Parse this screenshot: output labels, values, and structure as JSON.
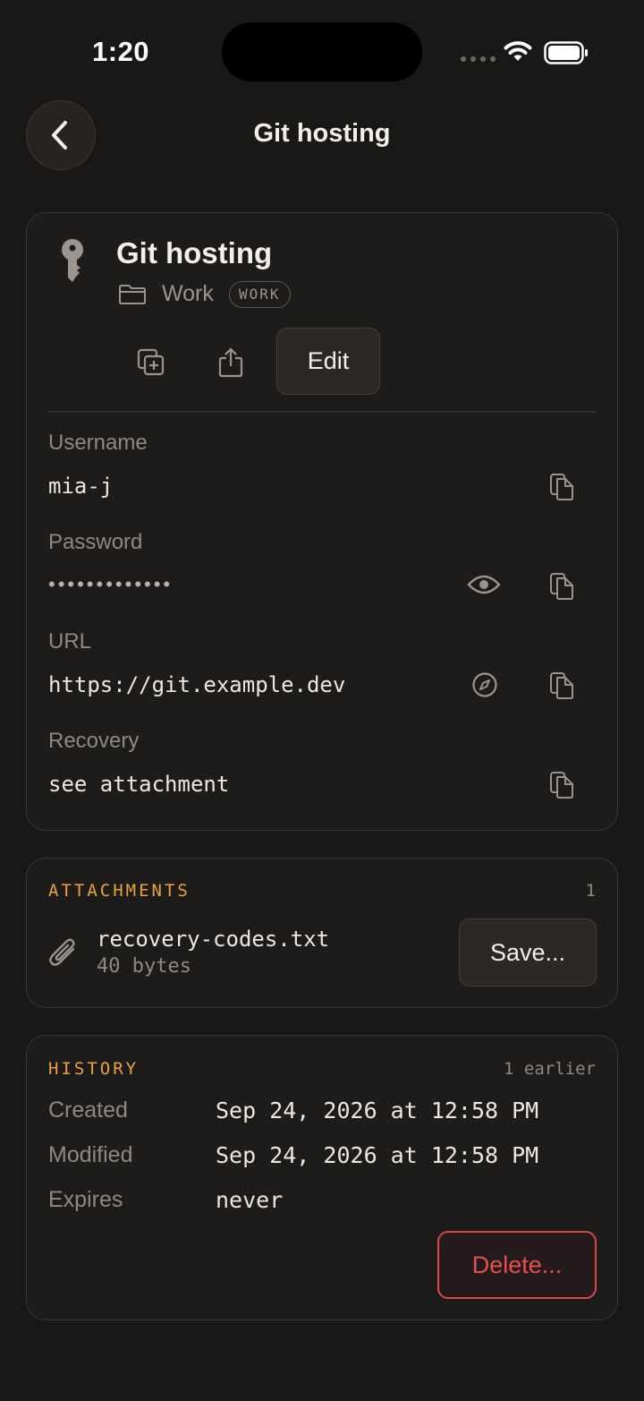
{
  "status_bar": {
    "time": "1:20"
  },
  "nav": {
    "title": "Git hosting"
  },
  "entry": {
    "title": "Git hosting",
    "folder": "Work",
    "tag": "WORK",
    "edit_label": "Edit"
  },
  "fields": {
    "username": {
      "label": "Username",
      "value": "mia-j"
    },
    "password": {
      "label": "Password",
      "value": "•••••••••••••"
    },
    "url": {
      "label": "URL",
      "value": "https://git.example.dev"
    },
    "recovery": {
      "label": "Recovery",
      "value": "see attachment"
    }
  },
  "attachments": {
    "title": "ATTACHMENTS",
    "count": "1",
    "file_name": "recovery-codes.txt",
    "file_size": "40 bytes",
    "save_label": "Save..."
  },
  "history": {
    "title": "HISTORY",
    "earlier": "1 earlier",
    "created_label": "Created",
    "created_value": "Sep 24, 2026 at 12:58 PM",
    "modified_label": "Modified",
    "modified_value": "Sep 24, 2026 at 12:58 PM",
    "expires_label": "Expires",
    "expires_value": "never",
    "delete_label": "Delete..."
  },
  "colors": {
    "background": "#1a1817",
    "accent": "#e8a33a",
    "danger": "#e5504f"
  },
  "icons": [
    "chevron-left-icon",
    "key-icon",
    "folder-icon",
    "duplicate-icon",
    "share-icon",
    "copy-icon",
    "eye-icon",
    "compass-icon",
    "paperclip-icon",
    "wifi-icon",
    "battery-icon"
  ]
}
